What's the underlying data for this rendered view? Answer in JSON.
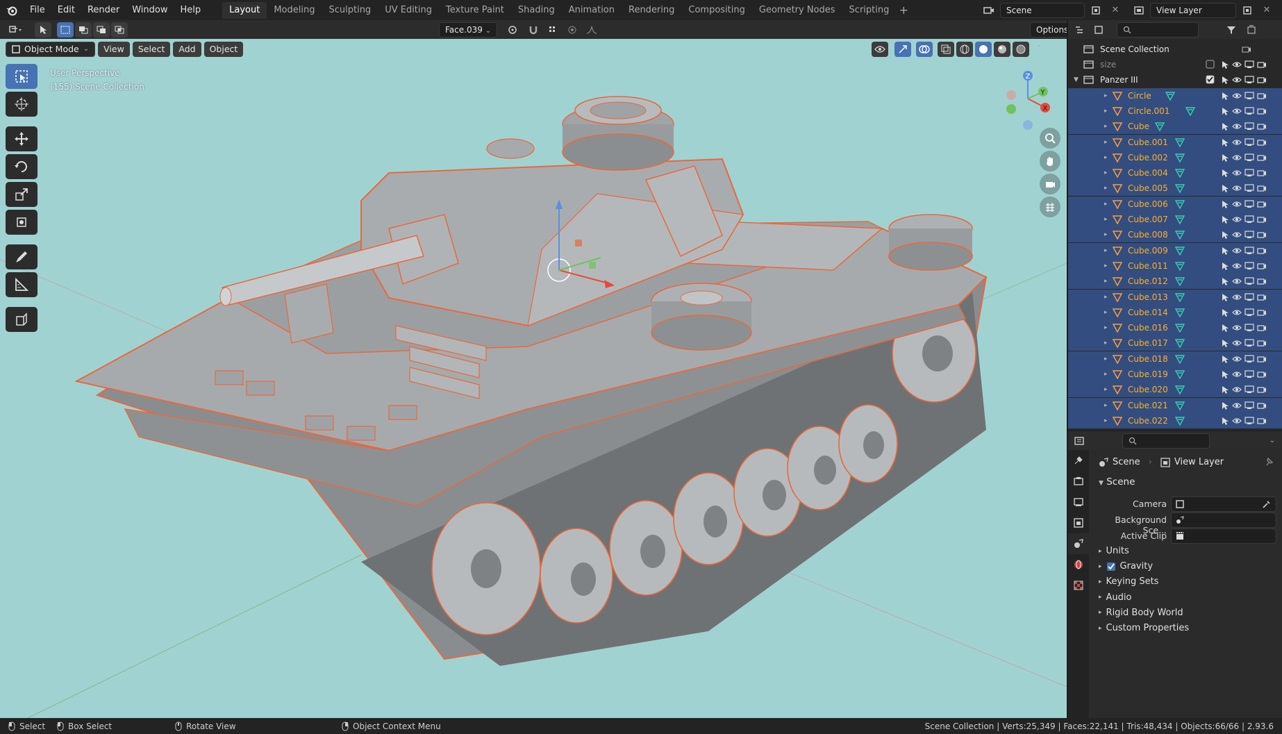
{
  "menubar": {
    "items": [
      "File",
      "Edit",
      "Render",
      "Window",
      "Help"
    ],
    "workspaces": [
      "Layout",
      "Modeling",
      "Sculpting",
      "UV Editing",
      "Texture Paint",
      "Shading",
      "Animation",
      "Rendering",
      "Compositing",
      "Geometry Nodes",
      "Scripting"
    ],
    "active_workspace": "Layout",
    "scene_name": "Scene",
    "view_layer_name": "View Layer"
  },
  "viewport_header": {
    "snap_target": "Face.039",
    "options_label": "Options",
    "mode": "Object Mode",
    "menus": [
      "View",
      "Select",
      "Add",
      "Object"
    ]
  },
  "viewport": {
    "info_line1": "User Perspective",
    "info_line2": "(155) Scene Collection",
    "bg_color": "#a1d2d2",
    "selection_outline_color": "#e8683c"
  },
  "toolbar": {
    "tools": [
      "select-box-icon",
      "cursor-icon",
      "move-icon",
      "rotate-icon",
      "scale-icon",
      "transform-icon",
      "annotate-icon",
      "measure-icon",
      "add-cube-icon"
    ]
  },
  "outliner": {
    "root": "Scene Collection",
    "rows": [
      {
        "name": "size",
        "level": 1,
        "selected": false,
        "type": "collection"
      },
      {
        "name": "Panzer III",
        "level": 1,
        "selected": true,
        "type": "collection"
      },
      {
        "name": "Circle",
        "level": 2,
        "selected": true,
        "type": "mesh"
      },
      {
        "name": "Circle.001",
        "level": 2,
        "selected": true,
        "type": "mesh"
      },
      {
        "name": "Cube",
        "level": 2,
        "selected": true,
        "type": "mesh"
      },
      {
        "name": "Cube.001",
        "level": 2,
        "selected": true,
        "type": "mesh"
      },
      {
        "name": "Cube.002",
        "level": 2,
        "selected": true,
        "type": "mesh"
      },
      {
        "name": "Cube.004",
        "level": 2,
        "selected": true,
        "type": "mesh"
      },
      {
        "name": "Cube.005",
        "level": 2,
        "selected": true,
        "type": "mesh"
      },
      {
        "name": "Cube.006",
        "level": 2,
        "selected": true,
        "type": "mesh"
      },
      {
        "name": "Cube.007",
        "level": 2,
        "selected": true,
        "type": "mesh"
      },
      {
        "name": "Cube.008",
        "level": 2,
        "selected": true,
        "type": "mesh"
      },
      {
        "name": "Cube.009",
        "level": 2,
        "selected": true,
        "type": "mesh"
      },
      {
        "name": "Cube.011",
        "level": 2,
        "selected": true,
        "type": "mesh"
      },
      {
        "name": "Cube.012",
        "level": 2,
        "selected": true,
        "type": "mesh"
      },
      {
        "name": "Cube.013",
        "level": 2,
        "selected": true,
        "type": "mesh"
      },
      {
        "name": "Cube.014",
        "level": 2,
        "selected": true,
        "type": "mesh"
      },
      {
        "name": "Cube.016",
        "level": 2,
        "selected": true,
        "type": "mesh"
      },
      {
        "name": "Cube.017",
        "level": 2,
        "selected": true,
        "type": "mesh"
      },
      {
        "name": "Cube.018",
        "level": 2,
        "selected": true,
        "type": "mesh"
      },
      {
        "name": "Cube.019",
        "level": 2,
        "selected": true,
        "type": "mesh"
      },
      {
        "name": "Cube.020",
        "level": 2,
        "selected": true,
        "type": "mesh"
      },
      {
        "name": "Cube.021",
        "level": 2,
        "selected": true,
        "type": "mesh"
      },
      {
        "name": "Cube.022",
        "level": 2,
        "selected": true,
        "type": "mesh"
      }
    ]
  },
  "properties": {
    "crumb_scene": "Scene",
    "crumb_view_layer": "View Layer",
    "panel_title": "Scene",
    "fields": [
      {
        "label": "Camera",
        "value": ""
      },
      {
        "label": "Background Sce...",
        "value": ""
      },
      {
        "label": "Active Clip",
        "value": ""
      }
    ],
    "subpanels": [
      {
        "label": "Units",
        "checkbox": false
      },
      {
        "label": "Gravity",
        "checkbox": true
      },
      {
        "label": "Keying Sets",
        "checkbox": false
      },
      {
        "label": "Audio",
        "checkbox": false
      },
      {
        "label": "Rigid Body World",
        "checkbox": false
      },
      {
        "label": "Custom Properties",
        "checkbox": false
      }
    ]
  },
  "statusbar": {
    "select": "Select",
    "box_select": "Box Select",
    "rotate_view": "Rotate View",
    "context_menu": "Object Context Menu",
    "stats": "Scene Collection | Verts:25,349 | Faces:22,141 | Tris:48,434 | Objects:66/66 | 2.93.6"
  }
}
